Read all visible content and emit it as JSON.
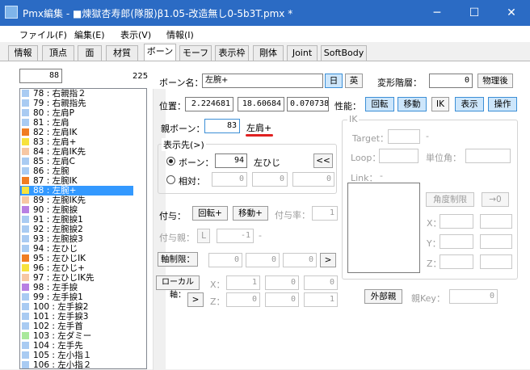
{
  "window": {
    "title": "Pmx編集 - ■煉獄杏寿郎(隊服)β1.05-改造無し0-5b3T.pmx *",
    "minimize": "─",
    "maximize": "☐",
    "close": "✕"
  },
  "menu": [
    "ファイル(F)",
    "編集(E)",
    "表示(V)",
    "情報(I)"
  ],
  "tabs": [
    "情報",
    "頂点",
    "面",
    "材質",
    "ボーン",
    "モーフ",
    "表示枠",
    "剛体",
    "Joint",
    "SoftBody"
  ],
  "active_tab": "ボーン",
  "list": {
    "index_value": "88",
    "count": "225",
    "rows": [
      {
        "t": "78 : 右親指２",
        "c": "#a9cbf2"
      },
      {
        "t": "79 : 右親指先",
        "c": "#a9cbf2"
      },
      {
        "t": "80 : 左肩P",
        "c": "#a9cbf2"
      },
      {
        "t": "81 : 左肩",
        "c": "#a9cbf2"
      },
      {
        "t": "82 : 左肩IK",
        "c": "#f07d22"
      },
      {
        "t": "83 : 左肩+",
        "c": "#f7e23d"
      },
      {
        "t": "84 : 左肩IK先",
        "c": "#f7c7a3"
      },
      {
        "t": "85 : 左肩C",
        "c": "#a9cbf2"
      },
      {
        "t": "86 : 左腕",
        "c": "#a9cbf2"
      },
      {
        "t": "87 : 左腕IK",
        "c": "#f07d22"
      },
      {
        "t": "88 : 左腕+",
        "c": "#f7e23d"
      },
      {
        "t": "89 : 左腕IK先",
        "c": "#f7c7a3"
      },
      {
        "t": "90 : 左腕捩",
        "c": "#b87fe3"
      },
      {
        "t": "91 : 左腕捩1",
        "c": "#a9cbf2"
      },
      {
        "t": "92 : 左腕捩2",
        "c": "#a9cbf2"
      },
      {
        "t": "93 : 左腕捩3",
        "c": "#a9cbf2"
      },
      {
        "t": "94 : 左ひじ",
        "c": "#a9cbf2"
      },
      {
        "t": "95 : 左ひじIK",
        "c": "#f07d22"
      },
      {
        "t": "96 : 左ひじ+",
        "c": "#f7e23d"
      },
      {
        "t": "97 : 左ひじIK先",
        "c": "#f7c7a3"
      },
      {
        "t": "98 : 左手捩",
        "c": "#b87fe3"
      },
      {
        "t": "99 : 左手捩1",
        "c": "#a9cbf2"
      },
      {
        "t": "100 : 左手捩2",
        "c": "#a9cbf2"
      },
      {
        "t": "101 : 左手捩3",
        "c": "#a9cbf2"
      },
      {
        "t": "102 : 左手首",
        "c": "#a9cbf2"
      },
      {
        "t": "103 : 左ダミー",
        "c": "#a9e89a"
      },
      {
        "t": "104 : 左手先",
        "c": "#a9cbf2"
      },
      {
        "t": "105 : 左小指１",
        "c": "#a9cbf2"
      },
      {
        "t": "106 : 左小指２",
        "c": "#a9cbf2"
      }
    ],
    "selected_index": 10
  },
  "bone": {
    "name_label": "ボーン名：",
    "name": "左腕+",
    "lang_jp": "日",
    "lang_en": "英",
    "deform_label": "変形階層：",
    "deform": "0",
    "physics_after": "物理後",
    "pos_label": "位置：",
    "pos": [
      "2.224681",
      "18.60684",
      "0.0707386"
    ],
    "perf_label": "性能：",
    "perf": [
      "回転",
      "移動",
      "IK",
      "表示",
      "操作"
    ],
    "parent_label": "親ボーン：",
    "parent": "83",
    "parent_name": "左肩+",
    "display_label": "表示先(>)",
    "radio_bone": "ボーン：",
    "display_bone": "94",
    "display_bone_name": "左ひじ",
    "jump": "<<",
    "radio_rel": "相対：",
    "rel": [
      "0",
      "0",
      "0"
    ],
    "grant_label": "付与：",
    "grant_rot": "回転+",
    "grant_move": "移動+",
    "grant_rate_label": "付与率：",
    "grant_rate": "1",
    "grant_parent_label": "付与親：",
    "grant_parent_l": "L",
    "grant_parent": "-1",
    "grant_parent_name": "-",
    "axis_limit": "軸制限：",
    "axis": [
      "0",
      "0",
      "0"
    ],
    "axis_btn": ">",
    "local_axis": "ローカル軸：",
    "lx": [
      "1",
      "0",
      "0"
    ],
    "lz": [
      "0",
      "0",
      "1"
    ],
    "x_label": "X：",
    "z_label": "Z：",
    "local_btn": ">",
    "ext_parent": "外部親",
    "key_label": "親Key：",
    "key": "0"
  },
  "ik": {
    "title": "IK",
    "target_label": "Target：",
    "target_dash": "-",
    "loop_label": "Loop：",
    "unit_label": "単位角：",
    "link_label": "Link：",
    "link_dash": "-",
    "angle_limit": "角度制限",
    "to_zero": "→0",
    "x": "X：",
    "y": "Y：",
    "z": "Z："
  },
  "colors": {
    "titlebar": "#2b6bc4",
    "selection": "#3399ff",
    "underline": "#e02020"
  }
}
